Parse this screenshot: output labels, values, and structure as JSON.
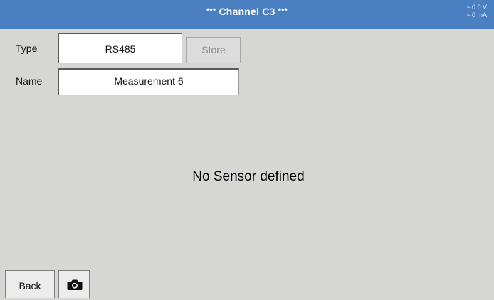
{
  "header": {
    "title_prefix": "***",
    "title": "Channel C3",
    "title_suffix": "***",
    "voltage_readout": "~ 0.0 V",
    "current_readout": "~ 0 mA",
    "background_color": "#4a7fc1"
  },
  "form": {
    "type_label": "Type",
    "type_value": "RS485",
    "store_label": "Store",
    "name_label": "Name",
    "name_value": "Measurement 6"
  },
  "main": {
    "message": "No Sensor defined"
  },
  "footer": {
    "back_label": "Back",
    "camera_icon": "camera-icon"
  }
}
